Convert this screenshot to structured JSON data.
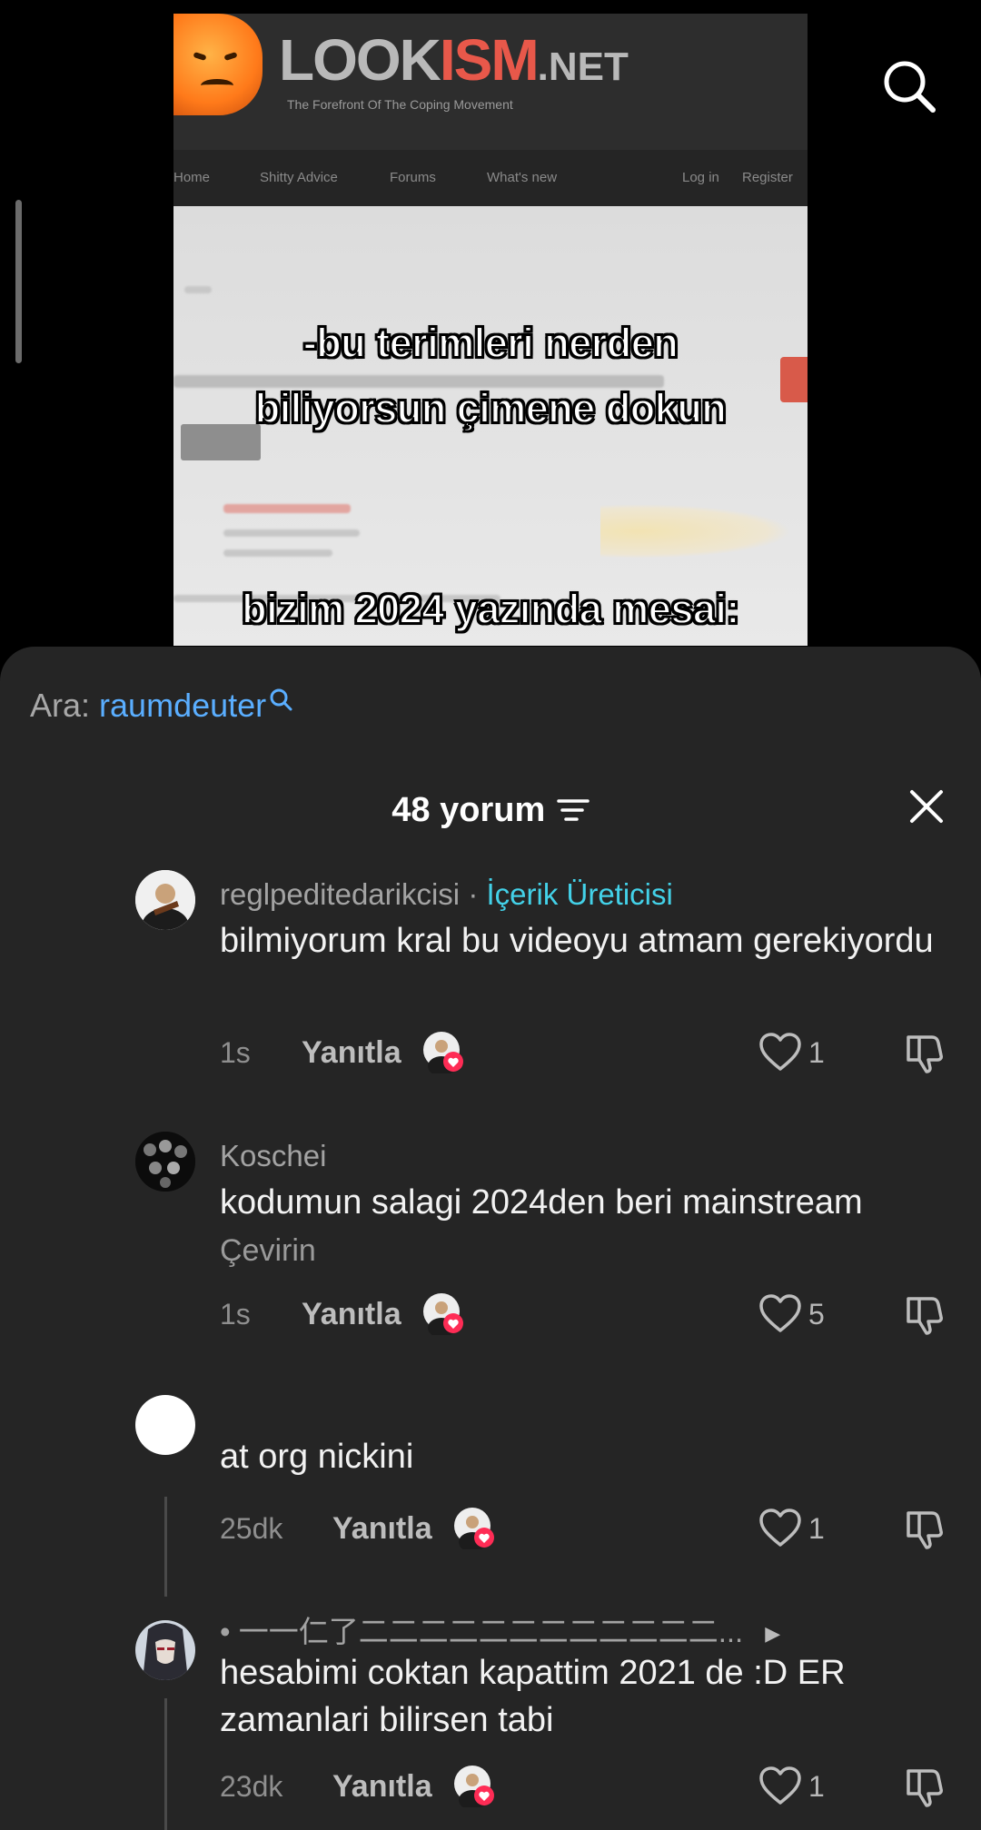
{
  "video": {
    "site_logo": "LOOKISM.NET",
    "site_tagline": "The Forefront Of The Coping Movement",
    "nav_items": [
      "Home",
      "Shitty Advice",
      "Forums",
      "What's new",
      "Log in",
      "Register"
    ],
    "caption_lines": [
      "-bu terimleri nerden",
      "biliyorsun çimene dokun",
      "bizim 2024 yazında mesai:"
    ]
  },
  "search_suggestion": {
    "label": "Ara:",
    "query": "raumdeuter"
  },
  "comments_header": {
    "count_label": "48 yorum"
  },
  "comments": [
    {
      "username": "reglpeditedarikcisi",
      "separator": "·",
      "badge": "İçerik Üreticisi",
      "text": "bilmiyorum kral bu videoyu atmam gerekiyordu",
      "time": "1s",
      "reply_label": "Yanıtla",
      "likes": "1"
    },
    {
      "username": "Koschei",
      "text": "kodumun salagi 2024den beri mainstream",
      "translate_label": "Çevirin",
      "time": "1s",
      "reply_label": "Yanıtla",
      "likes": "5"
    },
    {
      "username": "",
      "text": "at org nickini",
      "time": "25dk",
      "reply_label": "Yanıtla",
      "likes": "1"
    },
    {
      "username": "• 一一仁了二二二二二二二二二二二二...",
      "text": "hesabimi coktan kapattim 2021 de :D ER zamanlari bilirsen tabi",
      "time": "23dk",
      "reply_label": "Yanıtla",
      "likes": "1"
    }
  ],
  "colors": {
    "sheet_bg": "#252525",
    "link_blue": "#5aaeff",
    "creator_badge": "#43d1e8",
    "heart_badge": "#fe2c55"
  },
  "icons": [
    "search-icon",
    "filter-icon",
    "close-icon",
    "heart-icon",
    "dislike-icon",
    "caret-right-icon"
  ]
}
